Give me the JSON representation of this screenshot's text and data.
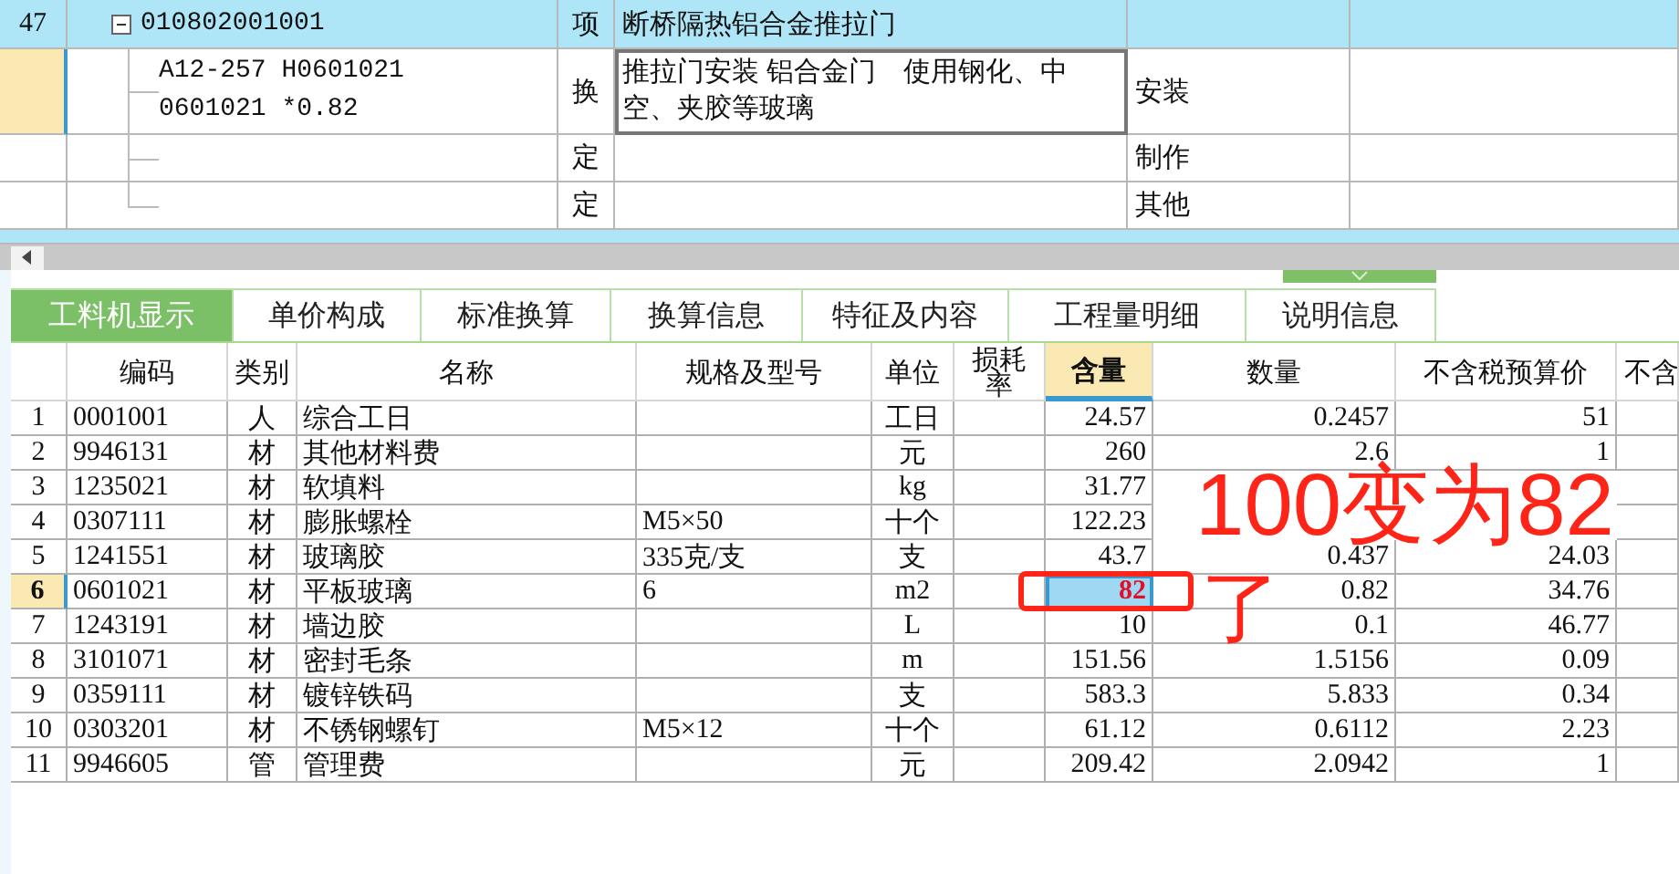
{
  "top_grid": {
    "rows": [
      {
        "kind": "item",
        "number": "47",
        "code": "010802001001",
        "type": "项",
        "name": "断桥隔热铝合金推拉门",
        "column_5": "",
        "selected": false,
        "expanded": true
      },
      {
        "kind": "sub",
        "code": "A12-257 H0601021 0601021 *0.82",
        "type": "换",
        "name": "推拉门安装 铝合金门　使用钢化、中空、夹胶等玻璃",
        "column_5": "安装",
        "selected": true
      },
      {
        "kind": "sub",
        "code": "",
        "type": "定",
        "name": "",
        "column_5": "制作",
        "selected": false
      },
      {
        "kind": "sub",
        "code": "",
        "type": "定",
        "name": "",
        "column_5": "其他",
        "selected": false
      }
    ]
  },
  "tabs": [
    {
      "label": "工料机显示",
      "selected": true
    },
    {
      "label": "单价构成",
      "selected": false
    },
    {
      "label": "标准换算",
      "selected": false
    },
    {
      "label": "换算信息",
      "selected": false
    },
    {
      "label": "特征及内容",
      "selected": false
    },
    {
      "label": "工程量明细",
      "selected": false
    },
    {
      "label": "说明信息",
      "selected": false
    }
  ],
  "table": {
    "columns": [
      {
        "label": "编码",
        "selected": false
      },
      {
        "label": "类别",
        "selected": false
      },
      {
        "label": "名称",
        "selected": false
      },
      {
        "label": "规格及型号",
        "selected": false
      },
      {
        "label": "单位",
        "selected": false
      },
      {
        "label": "损耗率",
        "selected": false
      },
      {
        "label": "含量",
        "selected": true
      },
      {
        "label": "数量",
        "selected": false
      },
      {
        "label": "不含税预算价",
        "selected": false
      },
      {
        "label": "不含",
        "selected": false
      }
    ],
    "rows": [
      {
        "number": "1",
        "code": "0001001",
        "category": "人",
        "name": "综合工日",
        "spec": "",
        "unit": "工日",
        "content": "24.57",
        "quantity": "0.2457",
        "price": "51",
        "selected": false,
        "modified": false
      },
      {
        "number": "2",
        "code": "9946131",
        "category": "材",
        "name": "其他材料费",
        "spec": "",
        "unit": "元",
        "content": "260",
        "quantity": "2.6",
        "price": "1",
        "selected": false,
        "modified": false
      },
      {
        "number": "3",
        "code": "1235021",
        "category": "材",
        "name": "软填料",
        "spec": "",
        "unit": "kg",
        "content": "31.77",
        "quantity": "",
        "price": "",
        "selected": false,
        "modified": false
      },
      {
        "number": "4",
        "code": "0307111",
        "category": "材",
        "name": "膨胀螺栓",
        "spec": "M5×50",
        "unit": "十个",
        "content": "122.23",
        "quantity": "",
        "price": "",
        "selected": false,
        "modified": false
      },
      {
        "number": "5",
        "code": "1241551",
        "category": "材",
        "name": "玻璃胶",
        "spec": "335克/支",
        "unit": "支",
        "content": "43.7",
        "quantity": "0.437",
        "price": "24.03",
        "selected": false,
        "modified": false
      },
      {
        "number": "6",
        "code": "0601021",
        "category": "材",
        "name": "平板玻璃",
        "spec": "6",
        "unit": "m2",
        "content": "82",
        "quantity": "0.82",
        "price": "34.76",
        "selected": true,
        "modified": true
      },
      {
        "number": "7",
        "code": "1243191",
        "category": "材",
        "name": "墙边胶",
        "spec": "",
        "unit": "L",
        "content": "10",
        "quantity": "0.1",
        "price": "46.77",
        "selected": false,
        "modified": false
      },
      {
        "number": "8",
        "code": "3101071",
        "category": "材",
        "name": "密封毛条",
        "spec": "",
        "unit": "m",
        "content": "151.56",
        "quantity": "1.5156",
        "price": "0.09",
        "selected": false,
        "modified": false
      },
      {
        "number": "9",
        "code": "0359111",
        "category": "材",
        "name": "镀锌铁码",
        "spec": "",
        "unit": "支",
        "content": "583.3",
        "quantity": "5.833",
        "price": "0.34",
        "selected": false,
        "modified": false
      },
      {
        "number": "10",
        "code": "0303201",
        "category": "材",
        "name": "不锈钢螺钉",
        "spec": "M5×12",
        "unit": "十个",
        "content": "61.12",
        "quantity": "0.6112",
        "price": "2.23",
        "selected": false,
        "modified": false
      },
      {
        "number": "11",
        "code": "9946605",
        "category": "管",
        "name": "管理费",
        "spec": "",
        "unit": "元",
        "content": "209.42",
        "quantity": "2.0942",
        "price": "1",
        "selected": false,
        "modified": false
      }
    ]
  },
  "annotations": [
    {
      "kind": "note",
      "text": "100变为82"
    },
    {
      "kind": "box"
    },
    {
      "kind": "mark",
      "text": "了"
    }
  ]
}
